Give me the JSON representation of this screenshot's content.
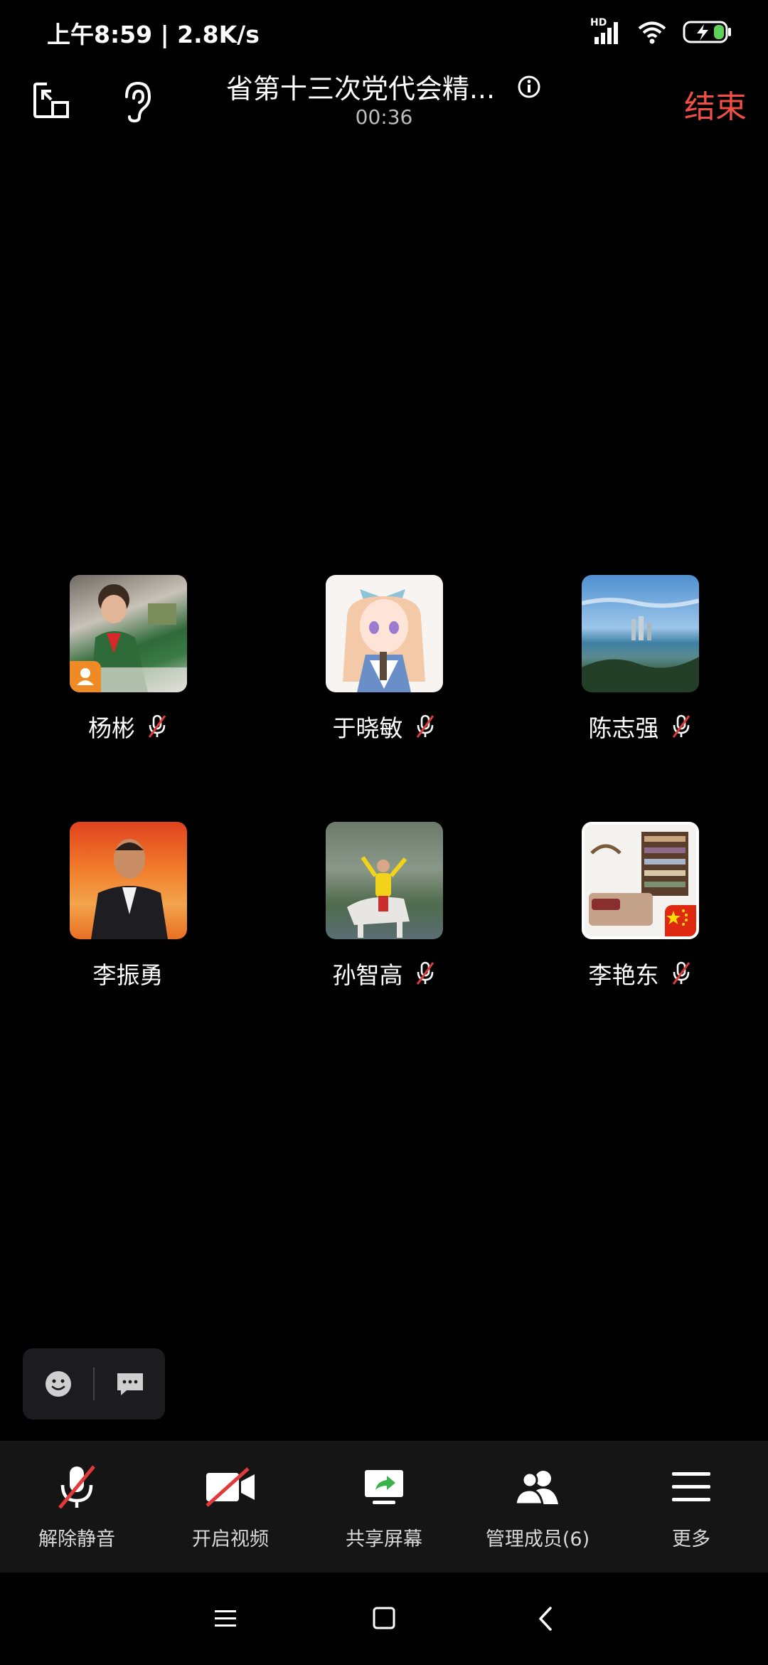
{
  "status_bar": {
    "time": "上午8:59 | 2.8K/s",
    "network_label": "HD",
    "icons": [
      "signal-icon",
      "wifi-icon",
      "battery-charging-icon"
    ]
  },
  "header": {
    "title": "省第十三次党代会精...",
    "timer": "00:36",
    "end_label": "结束",
    "icons": [
      "minimize-window-icon",
      "ear-icon",
      "info-icon"
    ]
  },
  "participants": [
    {
      "name": "杨彬",
      "muted": true,
      "host": true
    },
    {
      "name": "于晓敏",
      "muted": true
    },
    {
      "name": "陈志强",
      "muted": true
    },
    {
      "name": "李振勇",
      "muted": false
    },
    {
      "name": "孙智高",
      "muted": true
    },
    {
      "name": "李艳东",
      "muted": true
    }
  ],
  "chat_pill": {
    "icons": [
      "emoji-icon",
      "chat-bubble-icon"
    ]
  },
  "toolbar": {
    "unmute_label": "解除静音",
    "video_label": "开启视频",
    "share_label": "共享屏幕",
    "members_label": "管理成员(6)",
    "more_label": "更多"
  },
  "nav": {
    "icons": [
      "menu-icon",
      "home-icon",
      "back-icon"
    ]
  },
  "colors": {
    "accent_end": "#f04f45",
    "background": "#000000",
    "toolbar_bg": "#151515"
  }
}
